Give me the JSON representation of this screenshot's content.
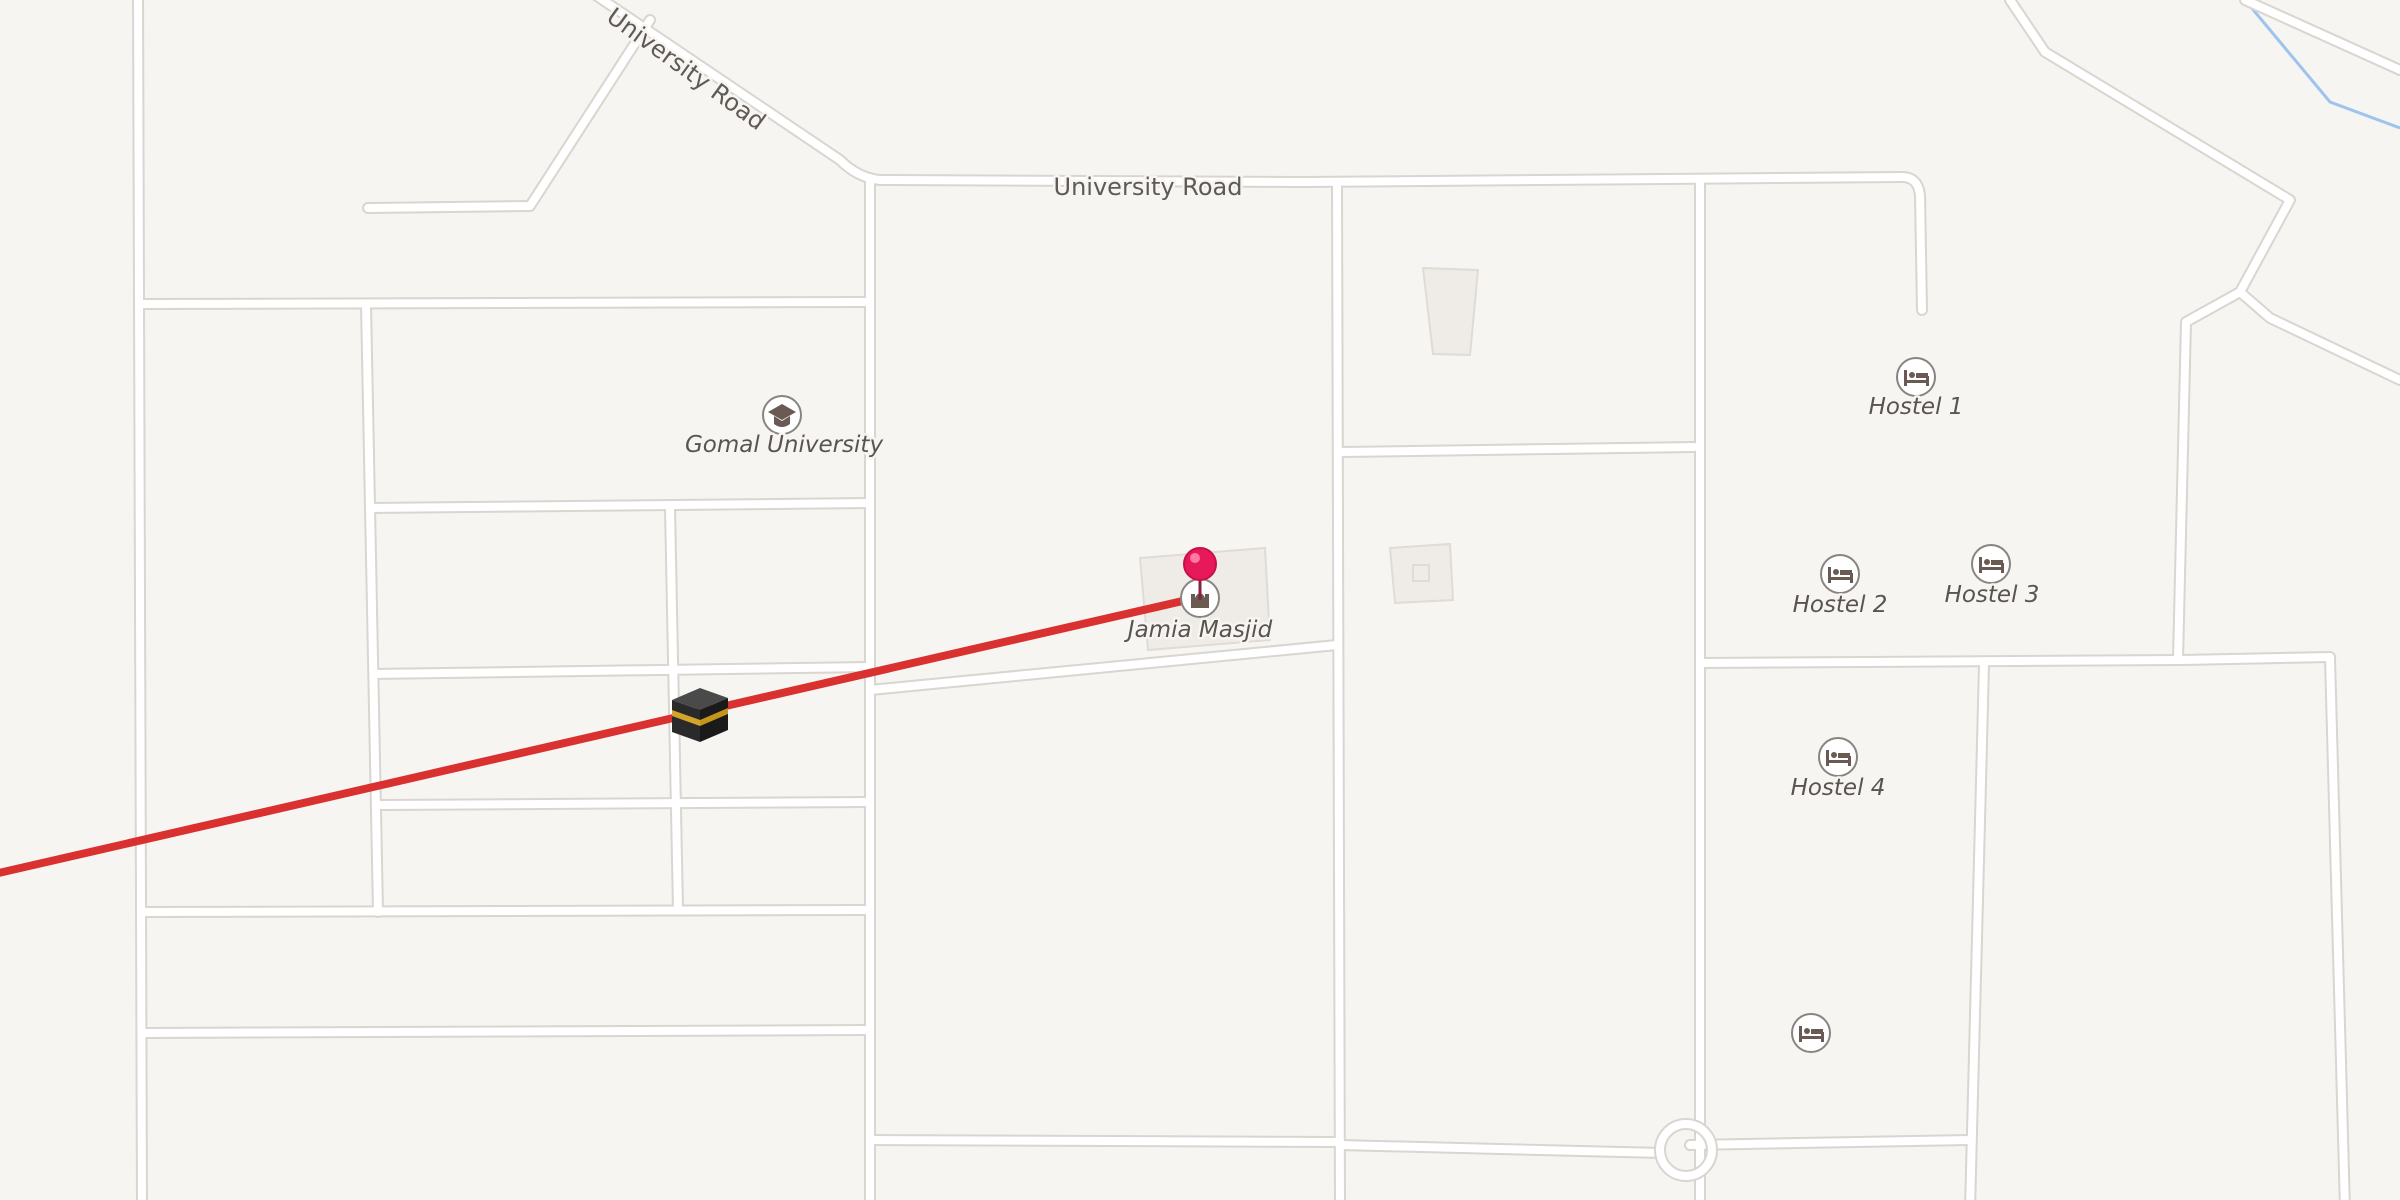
{
  "map": {
    "background_color": "#f7f5f2",
    "route_color": "#d93030",
    "marker_color": "#e8195a",
    "water_color": "#9cc4ee",
    "roads": [
      {
        "label": "University Road"
      },
      {
        "label": "University Road"
      }
    ],
    "pois": [
      {
        "label": "Gomal University",
        "icon": "graduation-cap-icon"
      },
      {
        "label": "Jamia Masjid",
        "icon": "mosque-icon"
      },
      {
        "label": "Hostel 1",
        "icon": "bed-icon"
      },
      {
        "label": "Hostel 2",
        "icon": "bed-icon"
      },
      {
        "label": "Hostel 3",
        "icon": "bed-icon"
      },
      {
        "label": "Hostel 4",
        "icon": "bed-icon"
      },
      {
        "label": "",
        "icon": "bed-icon"
      }
    ],
    "markers": [
      {
        "name": "selected-location-pin",
        "icon": "map-pin-icon"
      },
      {
        "name": "qibla-kaaba-marker",
        "icon": "kaaba-icon"
      }
    ]
  }
}
